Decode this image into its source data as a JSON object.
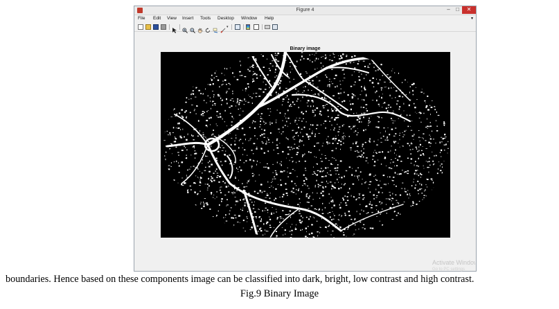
{
  "window": {
    "title": "Figure 4",
    "controls": {
      "minimize": "–",
      "maximize": "□",
      "close": "✕"
    }
  },
  "menubar": {
    "items": [
      "File",
      "Edit",
      "View",
      "Insert",
      "Tools",
      "Desktop",
      "Window",
      "Help"
    ],
    "overflow": "▾"
  },
  "toolbar": {
    "icons": [
      "new-figure-icon",
      "open-file-icon",
      "save-icon",
      "print-icon",
      "edit-plot-arrow-icon",
      "zoom-in-icon",
      "zoom-out-icon",
      "pan-icon",
      "rotate-3d-icon",
      "data-cursor-icon",
      "brush-icon",
      "link-plot-icon",
      "insert-colorbar-icon",
      "insert-legend-icon",
      "hide-plot-tools-icon",
      "show-plot-tools-icon"
    ]
  },
  "figure": {
    "plot_title": "Binary image"
  },
  "watermark": {
    "line1": "Activate Windows",
    "line2": "Go to PC settings"
  },
  "document": {
    "paragraph": "boundaries. Hence based on these components image can be classified into dark, bright, low contrast and high contrast.",
    "caption": "Fig.9 Binary Image"
  }
}
